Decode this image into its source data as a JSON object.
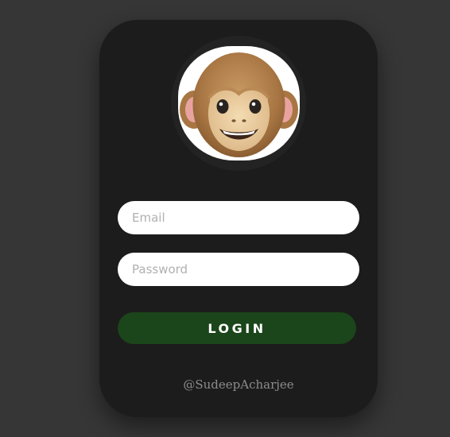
{
  "avatar": {
    "icon": "monkey-face-icon"
  },
  "form": {
    "email_placeholder": "Email",
    "password_placeholder": "Password",
    "login_label": "LOGIN"
  },
  "footer": {
    "credit": "@SudeepAcharjee"
  },
  "colors": {
    "page_background": "#363636",
    "card_background": "#1c1c1c",
    "login_button": "#1b451a",
    "input_background": "#ffffff"
  }
}
